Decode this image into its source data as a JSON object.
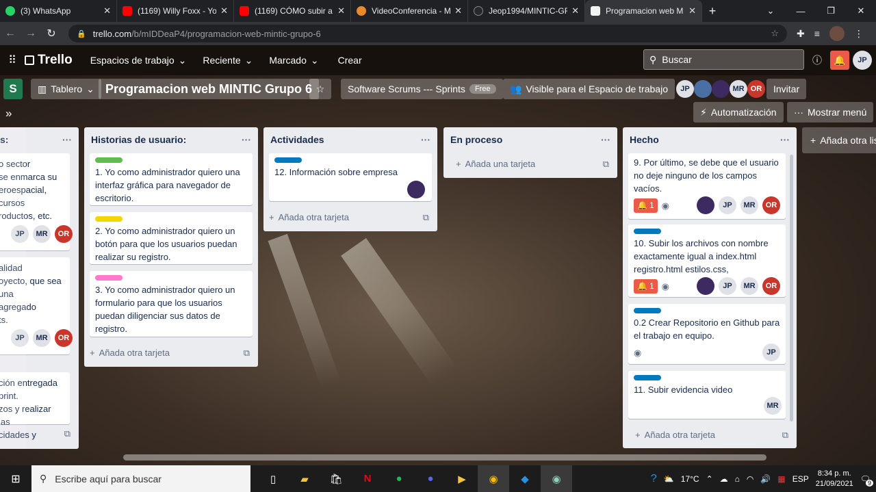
{
  "browser": {
    "tabs": [
      {
        "title": "(3) WhatsApp",
        "color": "#25d366"
      },
      {
        "title": "(1169) Willy Foxx - You",
        "color": "#ff0000"
      },
      {
        "title": "(1169) CÓMO subir a Í",
        "color": "#ff0000"
      },
      {
        "title": "VideoConferencia - M",
        "color": "#e8892b"
      },
      {
        "title": "Jeop1994/MINTIC-GR",
        "color": "#24292e"
      },
      {
        "title": "Programacion web M",
        "color": "#f3f3f3"
      }
    ],
    "url_domain": "trello.com",
    "url_path": "/b/mIDDeaP4/programacion-web-mintic-grupo-6"
  },
  "trello_header": {
    "logo": "Trello",
    "menus": [
      "Espacios de trabajo",
      "Reciente",
      "Marcado"
    ],
    "create": "Crear",
    "search_placeholder": "Buscar",
    "user_initials": "JP"
  },
  "board": {
    "workspace_letter": "S",
    "view": "Tablero",
    "title": "Programacion web MINTIC Grupo 6",
    "workspace": "Software Scrums --- Sprints",
    "plan": "Free",
    "visibility": "Visible para el Espacio de trabajo",
    "members": [
      "JP",
      "",
      "",
      "MR",
      "OR"
    ],
    "invite": "Invitar",
    "automation": "Automatización",
    "show_menu": "Mostrar menú",
    "add_list": "Añada otra lis"
  },
  "lists": {
    "l0": {
      "title": "s:",
      "c1": [
        "o sector",
        "se enmarca su",
        "eroespacial,",
        "cursos",
        "roductos, etc."
      ],
      "c2": [
        "alidad",
        "oyecto, que sea",
        "una",
        "agregado",
        "ts."
      ],
      "c3": [
        "ción entregada",
        "print.",
        "zos y realizar las",
        "cidades y"
      ]
    },
    "l1": {
      "title": "Historias de usuario:",
      "cards": [
        {
          "label": "#61bd4f",
          "text": "1. Yo como administrador quiero una interfaz gráfica para navegador de escritorio."
        },
        {
          "label": "#f2d600",
          "text": "2. Yo como administrador quiero un botón para que los usuarios puedan realizar su registro."
        },
        {
          "label": "#ff78cb",
          "text": "3. Yo como administrador quiero un formulario para que los usuarios puedan diligenciar sus datos de registro."
        }
      ],
      "add": "Añada otra tarjeta"
    },
    "l2": {
      "title": "Actividades",
      "cards": [
        {
          "label": "#0079bf",
          "text": "12. Información sobre empresa"
        }
      ],
      "add": "Añada otra tarjeta"
    },
    "l3": {
      "title": "En proceso",
      "add": "Añada una tarjeta"
    },
    "l4": {
      "title": "Hecho",
      "cards": [
        {
          "text": "9. Por último, se debe que el usuario no deje ninguno de los campos vacíos.",
          "badge": "1",
          "members": [
            "JP",
            "MR",
            "OR"
          ]
        },
        {
          "label": "#0079bf",
          "text": "10. Subir los archivos con nombre exactamente igual a index.html registro.html estilos.css,",
          "badge": "1",
          "members": [
            "JP",
            "MR",
            "OR"
          ]
        },
        {
          "label": "#0079bf",
          "text": "0.2 Crear Repositorio en Github para el trabajo en equipo.",
          "members": [
            "JP"
          ]
        },
        {
          "label": "#0079bf",
          "text": "11. Subir evidencia video",
          "members": [
            "MR"
          ]
        }
      ],
      "add": "Añada otra tarjeta"
    },
    "side_members": [
      "JP",
      "MR",
      "OR"
    ]
  },
  "taskbar": {
    "search_placeholder": "Escribe aquí para buscar",
    "temperature": "17°C",
    "language": "ESP",
    "time": "8:34 p. m.",
    "date": "21/09/2021",
    "notifications": "9"
  }
}
